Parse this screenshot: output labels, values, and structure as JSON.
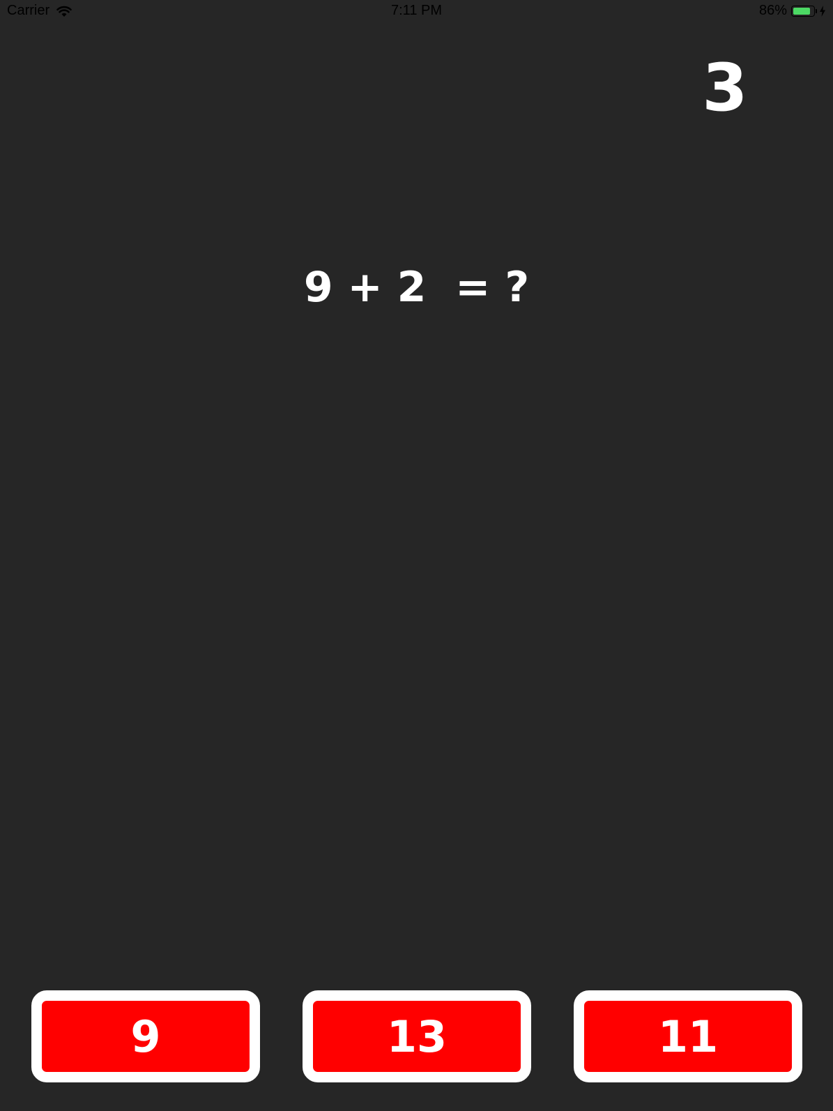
{
  "status_bar": {
    "carrier": "Carrier",
    "time": "7:11 PM",
    "battery_text": "86%",
    "battery_level": 0.86,
    "battery_color": "#4cd964",
    "icons": [
      "wifi-icon",
      "battery-icon",
      "charging-bolt-icon"
    ]
  },
  "game": {
    "score": "3",
    "question": "9 + 2  = ?",
    "background_color": "#262626",
    "answers": [
      {
        "label": "9"
      },
      {
        "label": "13"
      },
      {
        "label": "11"
      }
    ],
    "answer_fill_color": "#ff0000",
    "answer_border_color": "#ffffff"
  }
}
